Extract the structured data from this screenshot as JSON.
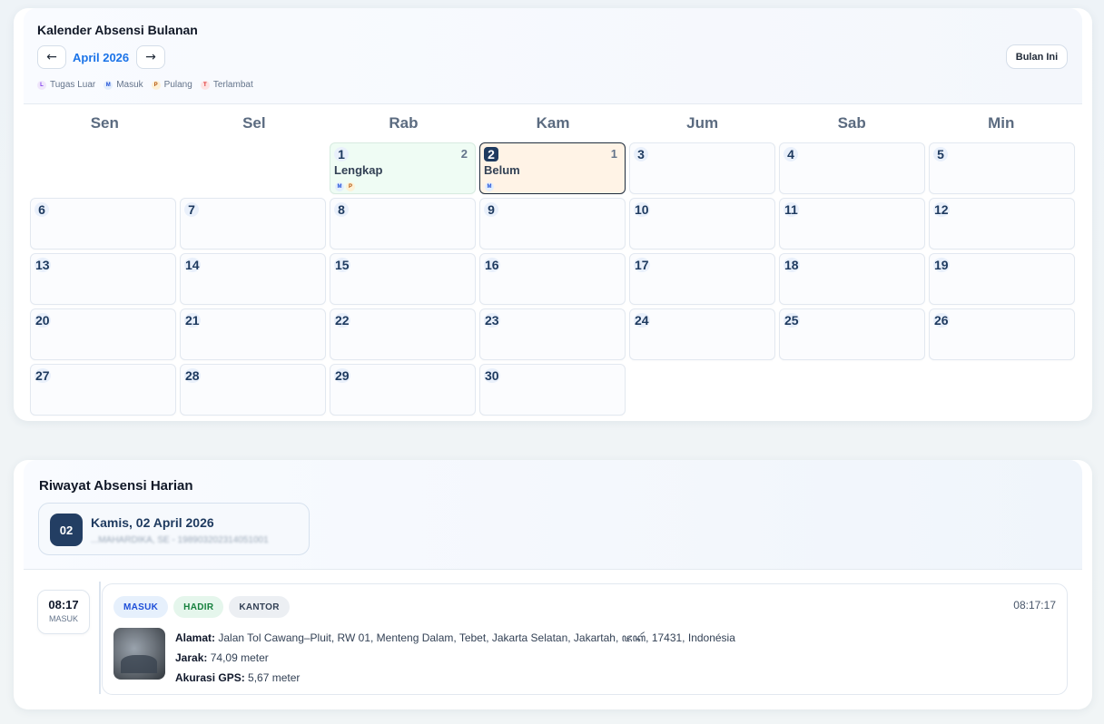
{
  "calendar": {
    "title": "Kalender Absensi Bulanan",
    "prev_label": "←",
    "next_label": "→",
    "month_label": "April 2026",
    "today_label": "Bulan Ini",
    "legend": [
      {
        "code": "L",
        "label": "Tugas Luar",
        "bg": "#efe6fb",
        "fg": "#7c3aed"
      },
      {
        "code": "M",
        "label": "Masuk",
        "bg": "#e3eefc",
        "fg": "#1d4ed8"
      },
      {
        "code": "P",
        "label": "Pulang",
        "bg": "#fdf1d6",
        "fg": "#b45309"
      },
      {
        "code": "T",
        "label": "Terlambat",
        "bg": "#fde4e4",
        "fg": "#dc2626"
      }
    ],
    "weekdays": [
      "Sen",
      "Sel",
      "Rab",
      "Kam",
      "Jum",
      "Sab",
      "Min"
    ],
    "days": {
      "d1": "1",
      "d2": "2",
      "d3": "3",
      "d4": "4",
      "d5": "5",
      "d6": "6",
      "d7": "7",
      "d8": "8",
      "d9": "9",
      "d10": "10",
      "d11": "11",
      "d12": "12",
      "d13": "13",
      "d14": "14",
      "d15": "15",
      "d16": "16",
      "d17": "17",
      "d18": "18",
      "d19": "19",
      "d20": "20",
      "d21": "21",
      "d22": "22",
      "d23": "23",
      "d24": "24",
      "d25": "25",
      "d26": "26",
      "d27": "27",
      "d28": "28",
      "d29": "29",
      "d30": "30"
    },
    "day1": {
      "count": "2",
      "status": "Lengkap",
      "badge1": "M",
      "badge2": "P"
    },
    "day2": {
      "count": "1",
      "status": "Belum",
      "badge1": "M"
    }
  },
  "history": {
    "title": "Riwayat Absensi Harian",
    "date_badge": "02",
    "date_text": "Kamis, 02 April 2026",
    "date_sub": "...MAHARDIKA, SE - 198903202314051001",
    "entry": {
      "time": "08:17",
      "time_label": "MASUK",
      "tags": [
        "MASUK",
        "HADIR",
        "KANTOR"
      ],
      "timestamp": "08:17:17",
      "address_label": "Alamat:",
      "address": "Jalan Tol Cawang–Pluit, RW 01, Menteng Dalam, Tebet, Jakarta Selatan, Jakartah, ꦗꦏꦂ, 17431, Indonésia",
      "distance_label": "Jarak:",
      "distance": "74,09 meter",
      "gps_label": "Akurasi GPS:",
      "gps": "5,67 meter"
    }
  }
}
